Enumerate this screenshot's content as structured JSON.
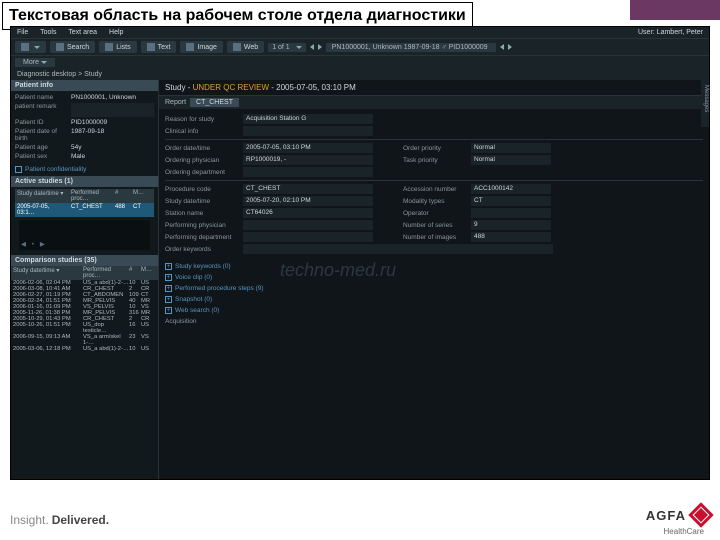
{
  "slide_title": "Текстовая область на рабочем столе отдела диагностики",
  "menubar": {
    "items": [
      "File",
      "Tools",
      "Text area",
      "Help"
    ],
    "user_label": "User:",
    "user_name": "Lambert, Peter"
  },
  "toolbar": {
    "search": "Search",
    "lists": "Lists",
    "text": "Text",
    "image": "Image",
    "web": "Web",
    "pager": "1 of 1",
    "search_text": "PN1000001, Unknown 1987-09-18 ♂ PID1000009",
    "more": "More"
  },
  "breadcrumb": "Diagnostic desktop > Study",
  "patient_info": {
    "title": "Patient info",
    "name_label": "Patient name",
    "name": "PN1000001, Unknown",
    "remark_label": "patient remark",
    "id_label": "Patient ID",
    "id": "PID1000009",
    "dob_label": "Patient date of birth",
    "dob": "1987-09-18",
    "age_label": "Patient age",
    "age": "54y",
    "sex_label": "Patient sex",
    "sex": "Male",
    "confidentiality": "Patient confidentiality"
  },
  "active_studies": {
    "title": "Active studies (1)",
    "cols": [
      "Study date/time ▾",
      "Performed proc…",
      "#",
      "M…"
    ],
    "row": [
      "2005-07-05, 03:1…",
      "CT_CHEST",
      "488",
      "CT"
    ]
  },
  "comparison": {
    "title": "Comparison studies (35)",
    "cols": [
      "Study date/time ▾",
      "Performed proc…",
      "#",
      "M…"
    ],
    "rows": [
      [
        "2006-02-06, 02:04 PM",
        "US_a abd(1)-2-…",
        "10",
        "US"
      ],
      [
        "2006-03-08, 10:41 AM",
        "CR_CHEST",
        "2",
        "CR"
      ],
      [
        "2006-02-27, 01:19 PM",
        "CT_ABDOMEN",
        "109",
        "CT"
      ],
      [
        "2006-02-24, 01:51 PM",
        "MR_PELVIS",
        "40",
        "MR"
      ],
      [
        "2006-01-16, 01:09 PM",
        "VS_PELVIS",
        "10",
        "VS"
      ],
      [
        "2005-11-26, 01:38 PM",
        "MR_PELVIS",
        "316",
        "MR"
      ],
      [
        "2005-10-29, 01:43 PM",
        "CR_CHEST",
        "2",
        "CR"
      ],
      [
        "2005-10-26, 01:51 PM",
        "US_dop testicle…",
        "16",
        "US"
      ],
      [
        "2006-09-15, 09:13 AM",
        "VS_a arm/skel 1-…",
        "23",
        "VS"
      ],
      [
        "2005-03-06, 12:18 PM",
        "US_a abd(1)-2-…",
        "10",
        "US"
      ]
    ]
  },
  "study": {
    "title_prefix": "Study - ",
    "qc": "UNDER QC REVIEW",
    "title_suffix": " - 2005-07-05, 03:10 PM",
    "report_label": "Report",
    "report_tab": "CT_CHEST",
    "reason_label": "Reason for study",
    "reason": "Acquisition Station G",
    "clinical_label": "Clinical info",
    "order_dt_label": "Order date/time",
    "order_dt": "2005-07-05, 03:10 PM",
    "order_prio_label": "Order priority",
    "order_prio": "Normal",
    "ord_phys_label": "Ordering physician",
    "ord_phys": "RP1000019, -",
    "task_prio_label": "Task priority",
    "task_prio": "Normal",
    "ord_dept_label": "Ordering department",
    "proc_code_label": "Procedure code",
    "proc_code": "CT_CHEST",
    "acc_label": "Accession number",
    "acc": "ACC1000142",
    "study_dt_label": "Study date/time",
    "study_dt": "2005-07-20, 02:10 PM",
    "mod_label": "Modality types",
    "mod": "CT",
    "station_label": "Station name",
    "station": "CT64026",
    "operator_label": "Operator",
    "perf_phys_label": "Performing physician",
    "num_series_label": "Number of series",
    "num_series": "9",
    "perf_dept_label": "Performing department",
    "num_images_label": "Number of images",
    "num_images": "488",
    "order_kw_label": "Order keywords"
  },
  "collapsibles": {
    "study_keywords": "Study keywords (0)",
    "voice_clip": "Voice clip (0)",
    "performed": "Performed procedure steps (9)",
    "snapshot": "Snapshot (0)",
    "web_search": "Web search (0)",
    "acquisition": "Acquisition"
  },
  "sidetab": "Messages",
  "watermark": "techno-med.ru",
  "footer": {
    "tagline_a": "Insight.",
    "tagline_b": "Delivered.",
    "brand": "AGFA",
    "sub": "HealthCare"
  }
}
